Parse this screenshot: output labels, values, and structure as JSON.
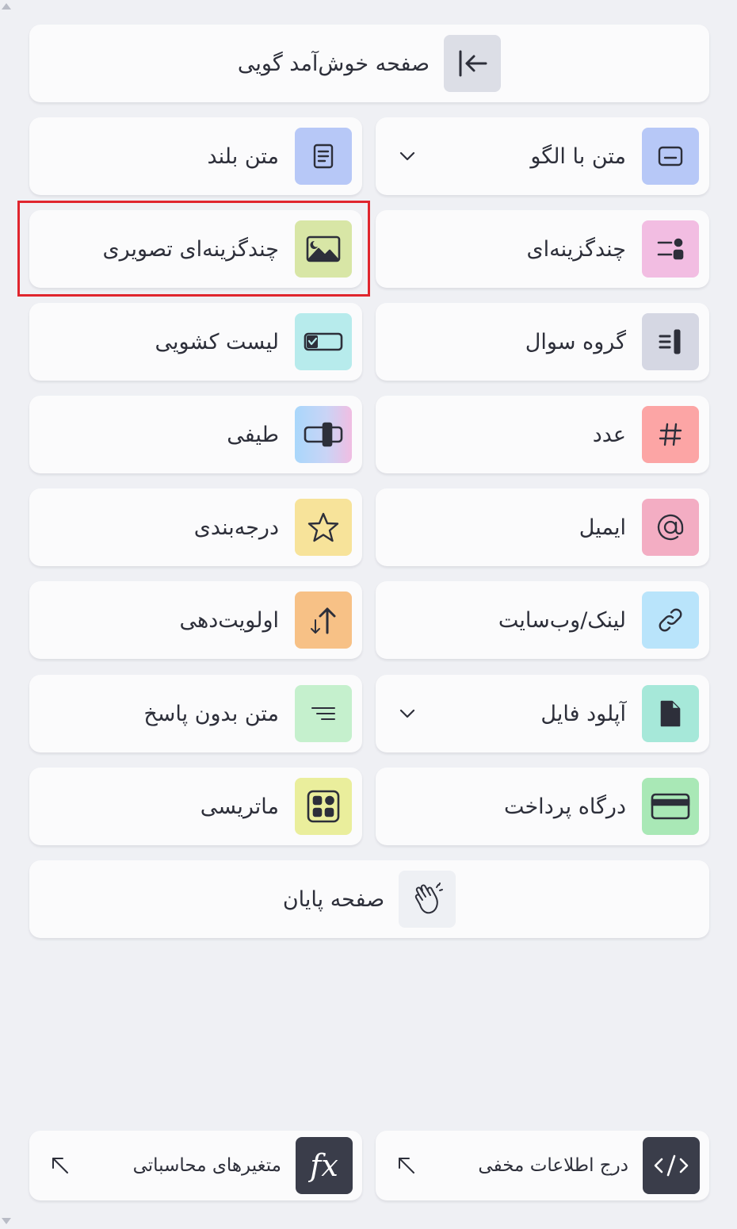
{
  "welcome": {
    "label": "صفحه خوش‌آمد گویی",
    "icon": "arrow-left-to-line-icon",
    "tile_color": "#dcdee6"
  },
  "items": [
    {
      "key": "pattern_text",
      "label": "متن با الگو",
      "icon": "form-field-icon",
      "tile_color": "#b7c8f7",
      "has_dropdown": true
    },
    {
      "key": "long_text",
      "label": "متن بلند",
      "icon": "document-lines-icon",
      "tile_color": "#b7c8f7"
    },
    {
      "key": "multiple_choice",
      "label": "چندگزینه‌ای",
      "icon": "choice-list-icon",
      "tile_color": "#f2bde2"
    },
    {
      "key": "picture_choice",
      "label": "چندگزینه‌ای تصویری",
      "icon": "image-icon",
      "tile_color": "#d8e6a6"
    },
    {
      "key": "question_group",
      "label": "گروه سوال",
      "icon": "group-lines-icon",
      "tile_color": "#d5d7e3"
    },
    {
      "key": "dropdown_list",
      "label": "لیست کشویی",
      "icon": "dropdown-toggle-icon",
      "tile_color": "#b7ebec"
    },
    {
      "key": "number",
      "label": "عدد",
      "icon": "hash-icon",
      "tile_color": "#fca5a5"
    },
    {
      "key": "range",
      "label": "طیفی",
      "icon": "slider-icon",
      "tile_color": "#c9d4f6"
    },
    {
      "key": "email",
      "label": "ایمیل",
      "icon": "at-sign-icon",
      "tile_color": "#f3adc3"
    },
    {
      "key": "rating",
      "label": "درجه‌بندی",
      "icon": "star-icon",
      "tile_color": "#f7e39a"
    },
    {
      "key": "link",
      "label": "لینک/وب‌سایت",
      "icon": "link-icon",
      "tile_color": "#b9e4fb"
    },
    {
      "key": "ranking",
      "label": "اولویت‌دهی",
      "icon": "sort-arrows-icon",
      "tile_color": "#f7c186"
    },
    {
      "key": "file_upload",
      "label": "آپلود فایل",
      "icon": "file-icon",
      "tile_color": "#a6e8d9",
      "has_dropdown": true
    },
    {
      "key": "statement",
      "label": "متن بدون پاسخ",
      "icon": "text-align-icon",
      "tile_color": "#c5f0cd"
    },
    {
      "key": "payment",
      "label": "درگاه پرداخت",
      "icon": "credit-card-icon",
      "tile_color": "#a9e8b6"
    },
    {
      "key": "matrix",
      "label": "ماتریسی",
      "icon": "grid-icon",
      "tile_color": "#eaee9c"
    }
  ],
  "end_screen": {
    "label": "صفحه پایان",
    "icon": "clapping-hands-icon",
    "tile_color": "#eef0f4"
  },
  "bottom": {
    "hidden_fields": {
      "label": "درج اطلاعات مخفی",
      "icon": "code-icon"
    },
    "calculated_vars": {
      "label": "متغیرهای محاسباتی",
      "icon": "function-icon",
      "icon_text": "fx"
    }
  }
}
